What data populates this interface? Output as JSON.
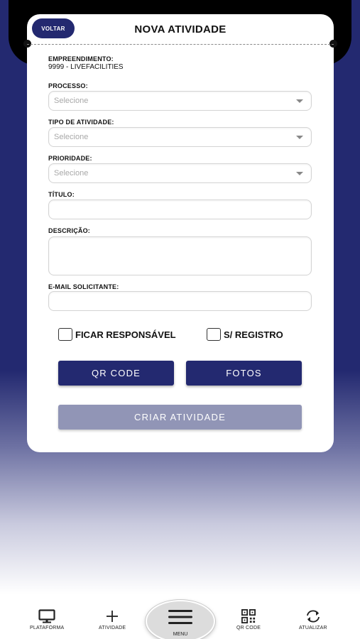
{
  "header": {
    "back_label": "VOLTAR",
    "title": "NOVA ATIVIDADE"
  },
  "form": {
    "empreendimento_label": "EMPREENDIMENTO:",
    "empreendimento_value": "9999 - LIVEFACILITIES",
    "processo_label": "PROCESSO:",
    "processo_placeholder": "Selecione",
    "tipo_label": "TIPO DE ATIVIDADE:",
    "tipo_placeholder": "Selecione",
    "prioridade_label": "PRIORIDADE:",
    "prioridade_placeholder": "Selecione",
    "titulo_label": "TÍTULO:",
    "titulo_value": "",
    "descricao_label": "DESCRIÇÃO:",
    "descricao_value": "",
    "email_label": "E-MAIL SOLICITANTE:",
    "email_value": "",
    "ficar_responsavel_label": "FICAR RESPONSÁVEL",
    "ficar_responsavel_checked": false,
    "sem_registro_label": "S/ REGISTRO",
    "sem_registro_checked": false,
    "qr_button": "QR CODE",
    "fotos_button": "FOTOS",
    "criar_button": "CRIAR ATIVIDADE"
  },
  "nav": {
    "plataforma": "PLATAFORMA",
    "atividade": "ATIVIDADE",
    "menu": "MENU",
    "qrcode": "QR CODE",
    "atualizar": "ATUALIZAR"
  },
  "colors": {
    "primary": "#232970",
    "disabled_button": "#9195b6"
  }
}
